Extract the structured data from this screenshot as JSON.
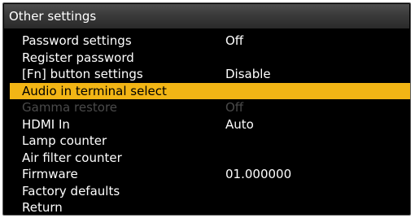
{
  "title": "Other settings",
  "colors": {
    "highlight": "#f2b515",
    "disabled_text": "#4a4a4a",
    "background": "#000000"
  },
  "items": [
    {
      "label": "Password settings",
      "value": "Off"
    },
    {
      "label": "Register password",
      "value": ""
    },
    {
      "label": "[Fn] button settings",
      "value": "Disable"
    },
    {
      "label": "Audio in terminal select",
      "value": "",
      "selected": true
    },
    {
      "label": "Gamma restore",
      "value": "Off",
      "disabled": true
    },
    {
      "label": "HDMI In",
      "value": "Auto"
    },
    {
      "label": "Lamp counter",
      "value": ""
    },
    {
      "label": "Air filter counter",
      "value": ""
    },
    {
      "label": "Firmware",
      "value": "01.000000"
    },
    {
      "label": "Factory defaults",
      "value": ""
    },
    {
      "label": "Return",
      "value": ""
    }
  ]
}
